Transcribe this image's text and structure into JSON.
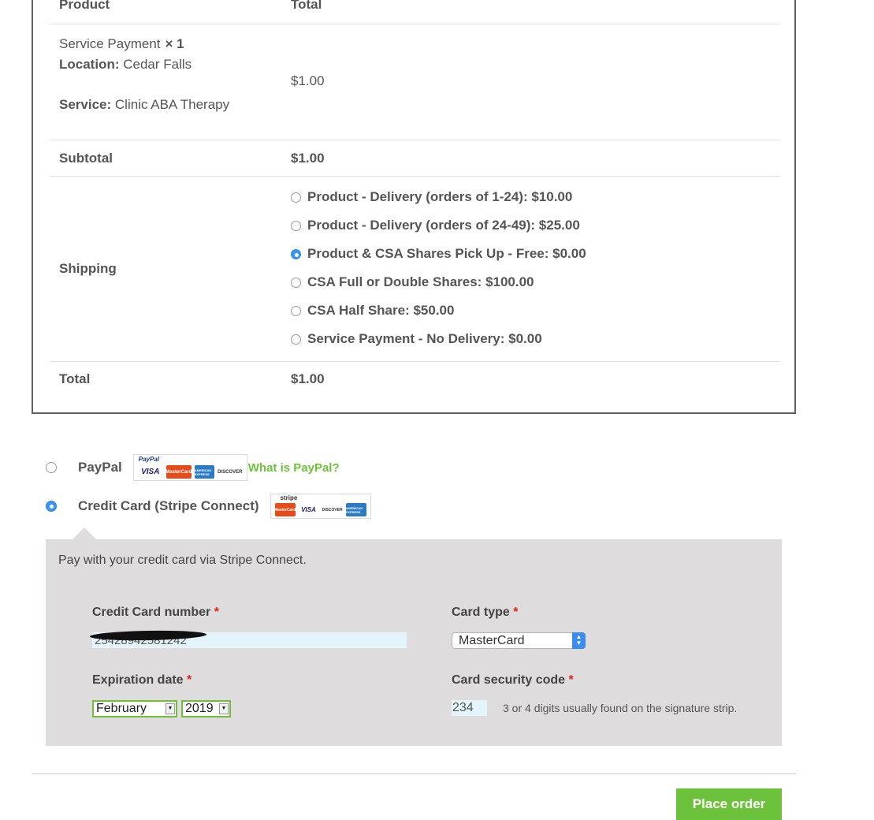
{
  "table": {
    "header_product": "Product",
    "header_total": "Total",
    "item": {
      "name": "Service Payment",
      "qty": "× 1",
      "location_label": "Location:",
      "location_value": "Cedar Falls",
      "service_label": "Service:",
      "service_value": "Clinic ABA Therapy",
      "total": "$1.00"
    },
    "subtotal_label": "Subtotal",
    "subtotal_value": "$1.00",
    "shipping_label": "Shipping",
    "shipping_options": [
      {
        "label": "Product - Delivery (orders of 1-24): $10.00",
        "selected": false
      },
      {
        "label": "Product - Delivery (orders of 24-49): $25.00",
        "selected": false
      },
      {
        "label": "Product & CSA Shares Pick Up - Free: $0.00",
        "selected": true
      },
      {
        "label": "CSA Full or Double Shares: $100.00",
        "selected": false
      },
      {
        "label": "CSA Half Share: $50.00",
        "selected": false
      },
      {
        "label": "Service Payment - No Delivery: $0.00",
        "selected": false
      }
    ],
    "total_label": "Total",
    "total_value": "$1.00"
  },
  "payment": {
    "paypal_label": "PayPal",
    "paypal_logo_text": "PayPal",
    "what_is_paypal": "What is PayPal?",
    "stripe_label": "Credit Card (Stripe Connect)",
    "stripe_logo_text": "stripe",
    "selected": "stripe",
    "logos": {
      "visa": "VISA",
      "mastercard": "MasterCard",
      "amex": "AMERICAN EXPRESS",
      "discover": "DISCOVER"
    }
  },
  "stripe_form": {
    "description": "Pay with your credit card via Stripe Connect.",
    "cc_number_label": "Credit Card number",
    "cc_number_value": "25428942581242",
    "card_type_label": "Card type",
    "card_type_value": "MasterCard",
    "expiration_label": "Expiration date",
    "exp_month": "February",
    "exp_year": "2019",
    "cvc_label": "Card security code",
    "cvc_value": "234",
    "cvc_hint": "3 or 4 digits usually found on the signature strip.",
    "required_mark": "*"
  },
  "place_order_label": "Place order",
  "colors": {
    "accent_green": "#6cc23a",
    "link_green": "#6cc23a",
    "radio_blue": "#3b95f0",
    "panel_bg": "#dfdcde",
    "required_red": "#e2231a"
  }
}
